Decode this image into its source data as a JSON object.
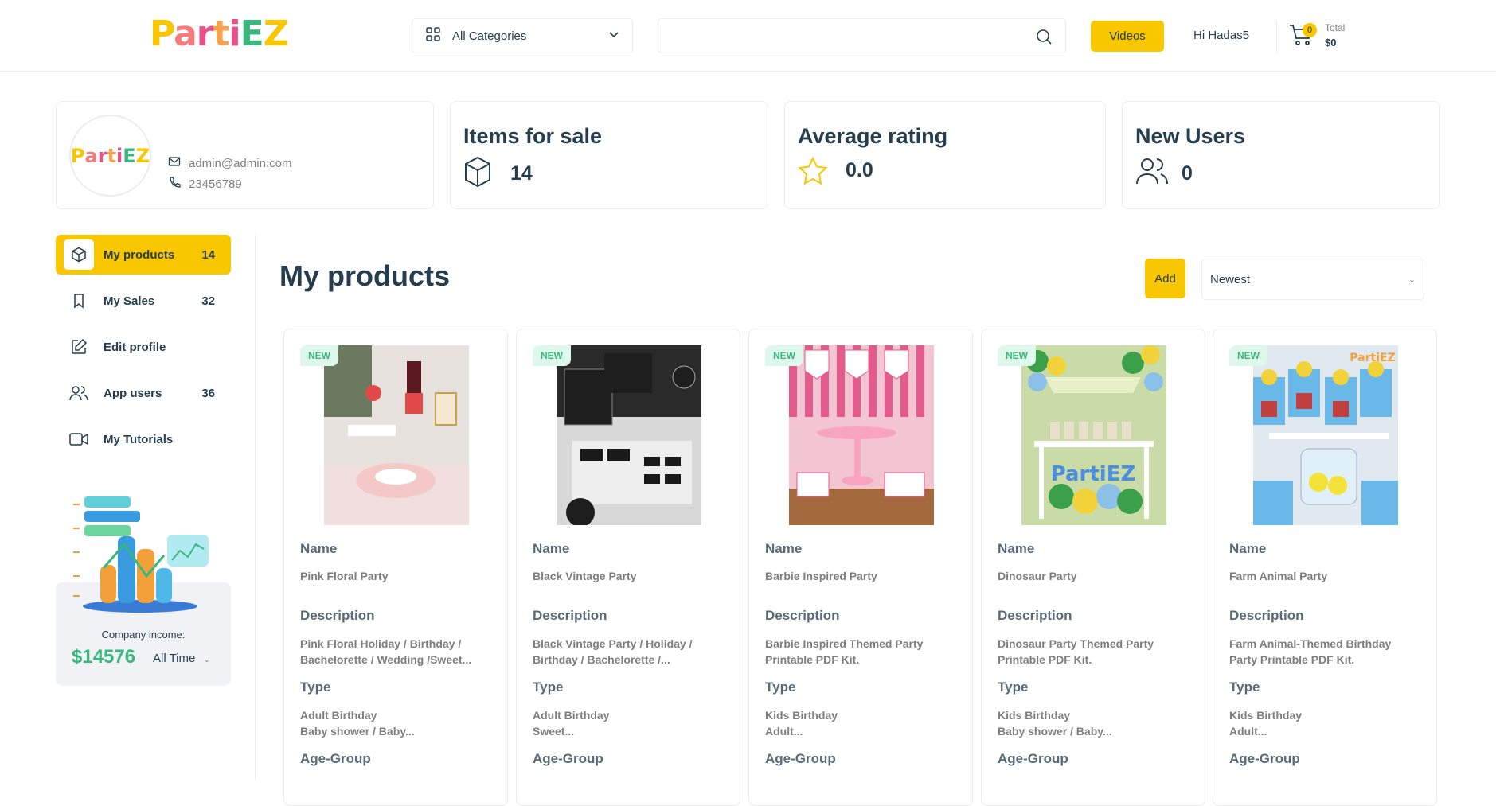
{
  "header": {
    "logo": "PartiEZ",
    "category_label": "All Categories",
    "search_placeholder": "",
    "videos_label": "Videos",
    "greeting": "Hi Hadas5",
    "cart_count": "0",
    "total_label": "Total",
    "total_value": "$0"
  },
  "profile": {
    "logo": "PartiEZ",
    "email": "admin@admin.com",
    "phone": "23456789"
  },
  "stats": [
    {
      "title": "Items for sale",
      "value": "14",
      "icon": "box-icon"
    },
    {
      "title": "Average rating",
      "value": "0.0",
      "icon": "star-icon"
    },
    {
      "title": "New Users",
      "value": "0",
      "icon": "users-icon"
    }
  ],
  "sidebar": {
    "items": [
      {
        "label": "My products",
        "count": "14",
        "icon": "box-icon",
        "active": true
      },
      {
        "label": "My Sales",
        "count": "32",
        "icon": "bookmark-icon"
      },
      {
        "label": "Edit profile",
        "count": "",
        "icon": "edit-icon"
      },
      {
        "label": "App users",
        "count": "36",
        "icon": "users-icon"
      },
      {
        "label": "My Tutorials",
        "count": "",
        "icon": "video-icon"
      }
    ],
    "income_label": "Company income:",
    "income_value": "$14576",
    "income_period": "All Time"
  },
  "main": {
    "title": "My products",
    "add_label": "Add",
    "sort_value": "Newest"
  },
  "product_labels": {
    "badge": "NEW",
    "name": "Name",
    "description": "Description",
    "type": "Type",
    "age_group": "Age-Group"
  },
  "products": [
    {
      "name": "Pink Floral Party",
      "description": "Pink Floral Holiday / Birthday /\nBachelorette / Wedding /Sweet...",
      "type": "Adult Birthday\nBaby shower / Baby..."
    },
    {
      "name": "Black Vintage Party",
      "description": "Black Vintage Party / Holiday /\nBirthday / Bachelorette /...",
      "type": "Adult Birthday\nSweet..."
    },
    {
      "name": "Barbie Inspired Party",
      "description": "Barbie Inspired Themed Party\nPrintable PDF Kit.",
      "type": "Kids Birthday\nAdult..."
    },
    {
      "name": "Dinosaur Party",
      "description": "Dinosaur Party Themed Party\nPrintable PDF Kit.",
      "type": "Kids Birthday\nBaby shower / Baby..."
    },
    {
      "name": "Farm Animal Party",
      "description": "Farm Animal-Themed Birthday\nParty Printable PDF Kit.",
      "type": "Kids Birthday\nAdult..."
    }
  ],
  "colors": {
    "accent": "#f8c700",
    "brand_green": "#3bb77e",
    "text": "#253d4e"
  }
}
